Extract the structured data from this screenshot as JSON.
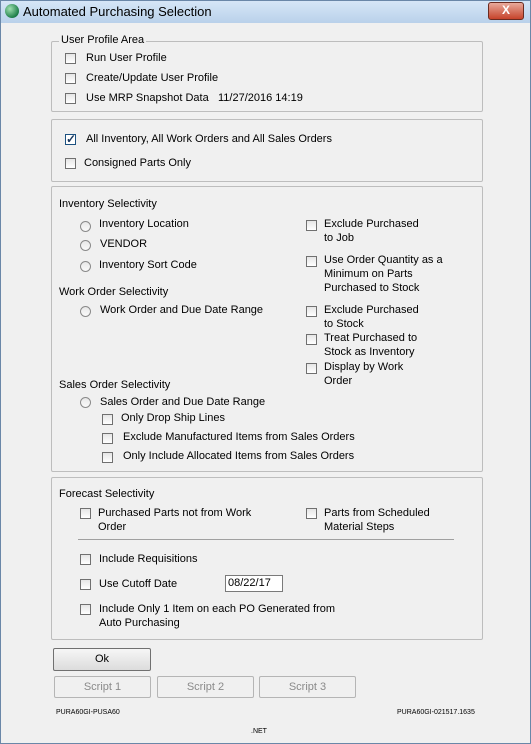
{
  "window": {
    "title": "Automated Purchasing Selection",
    "close_label": "X"
  },
  "user_profile": {
    "legend": "User Profile Area",
    "run_user_profile": "Run User Profile",
    "create_update_user_profile": "Create/Update User Profile",
    "use_mrp_snapshot": "Use MRP Snapshot Data",
    "snapshot_timestamp": "11/27/2016 14:19"
  },
  "scope": {
    "all_inventory": "All Inventory, All Work Orders and All Sales Orders",
    "all_inventory_checked": true,
    "consigned_parts_only": "Consigned Parts Only"
  },
  "selectivity": {
    "inventory_heading": "Inventory Selectivity",
    "inventory_location": "Inventory Location",
    "vendor": "VENDOR",
    "inventory_sort_code": "Inventory Sort Code",
    "work_order_heading": "Work Order Selectivity",
    "work_order_due_date": "Work Order and Due Date Range",
    "sales_order_heading": "Sales Order Selectivity",
    "sales_order_due_date": "Sales Order and Due Date Range",
    "only_drop_ship": "Only Drop Ship Lines",
    "exclude_manufactured": "Exclude Manufactured Items from Sales Orders",
    "only_allocated": "Only Include Allocated Items from Sales Orders",
    "exclude_purchased_job_1": "Exclude Purchased",
    "exclude_purchased_job_2": "to Job",
    "use_order_qty_1": "Use Order Quantity as a",
    "use_order_qty_2": "Minimum on Parts",
    "use_order_qty_3": "Purchased to Stock",
    "exclude_purchased_stock_1": "Exclude Purchased",
    "exclude_purchased_stock_2": "to Stock",
    "treat_purchased_1": "Treat Purchased to",
    "treat_purchased_2": "Stock as Inventory",
    "display_by_wo_1": "Display by Work",
    "display_by_wo_2": "Order"
  },
  "forecast": {
    "heading": "Forecast Selectivity",
    "purchased_parts_1": "Purchased Parts not from Work",
    "purchased_parts_2": "Order",
    "parts_scheduled_1": "Parts from Scheduled",
    "parts_scheduled_2": "Material Steps",
    "include_requisitions": "Include Requisitions",
    "use_cutoff_date": "Use Cutoff Date",
    "cutoff_date_value": "08/22/17",
    "include_only_1": "Include Only 1 Item on each PO Generated from",
    "include_only_2": "Auto Purchasing"
  },
  "buttons": {
    "ok": "Ok",
    "script1": "Script 1",
    "script2": "Script 2",
    "script3": "Script 3"
  },
  "footer": {
    "left_code": "PURA60GI-PUSA60",
    "right_code": "PURA60GI-021517.1635",
    "platform": ".NET"
  }
}
